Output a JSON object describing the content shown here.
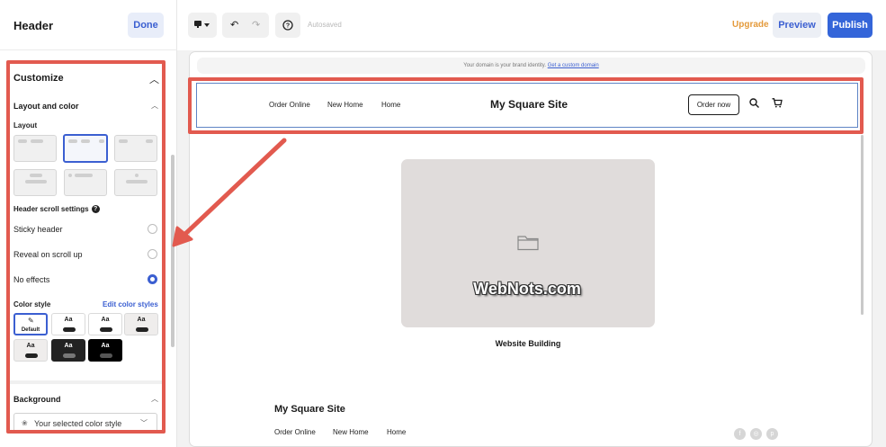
{
  "left_panel": {
    "title": "Header",
    "done_label": "Done",
    "customize": {
      "title": "Customize",
      "layout_and_color": "Layout and color",
      "layout_label": "Layout",
      "scroll_settings_label": "Header scroll settings",
      "scroll_options": [
        {
          "label": "Sticky header",
          "selected": false
        },
        {
          "label": "Reveal on scroll up",
          "selected": false
        },
        {
          "label": "No effects",
          "selected": true
        }
      ],
      "color_style_label": "Color style",
      "edit_color_styles": "Edit color styles",
      "color_swatch_text": "Aa",
      "default_label": "Default",
      "background_label": "Background",
      "background_select_value": "Your selected color style"
    }
  },
  "toolbar": {
    "autosaved": "Autosaved",
    "upgrade": "Upgrade",
    "preview": "Preview",
    "publish": "Publish"
  },
  "site": {
    "banner_text": "Your domain is your brand identity.",
    "banner_link": "Get a custom domain",
    "nav": [
      "Order Online",
      "New Home",
      "Home"
    ],
    "title": "My Square Site",
    "order_button": "Order now",
    "watermark": "WebNots.com",
    "image_caption": "Website Building",
    "footer_title": "My Square Site",
    "footer_nav": [
      "Order Online",
      "New Home",
      "Home"
    ],
    "social": [
      "f",
      "◎",
      "p"
    ]
  },
  "colors": {
    "accent": "#3b5fd1",
    "publish": "#3465d9",
    "upgrade": "#e49a3b",
    "highlight": "#e25a4f"
  }
}
